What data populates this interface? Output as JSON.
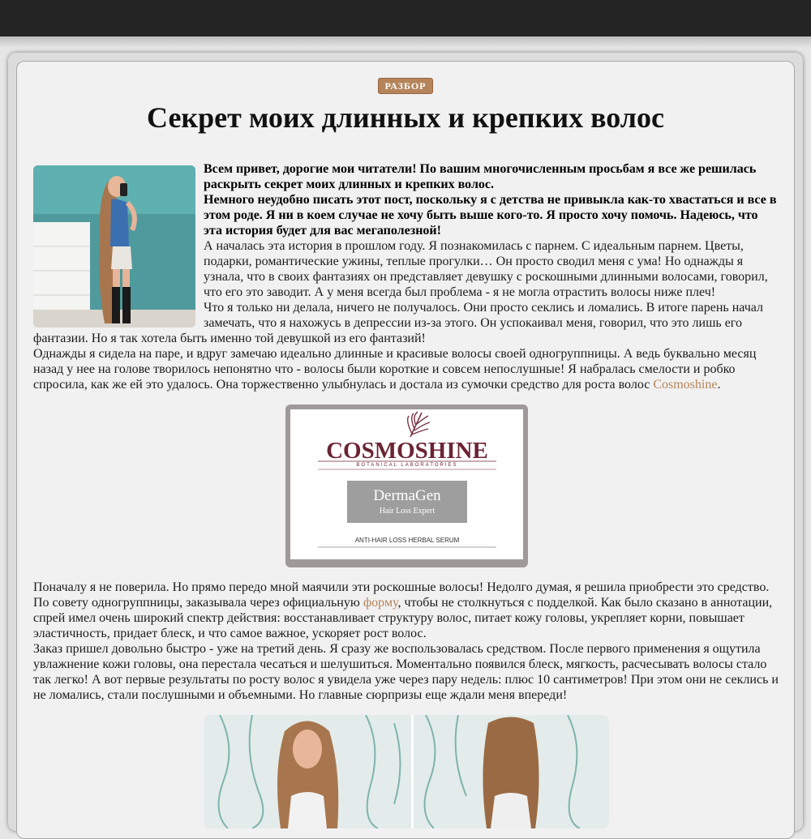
{
  "header": {},
  "article": {
    "badge": "РАЗБОР",
    "title": "Секрет моих длинных и крепких волос",
    "intro_bold_1": "Всем привет, дорогие мои читатели! По вашим многочисленным просьбам я все же решилась раскрыть секрет моих длинных и крепких волос.",
    "intro_bold_2": "Немного неудобно писать этот пост, поскольку я с детства не привыкла как-то хвастаться и все в этом роде. Я ни в коем случае не хочу быть выше кого-то. Я просто хочу помочь. Надеюсь, что эта история будет для вас мегаполезной!",
    "p1": "А началась эта история в прошлом году. Я познакомилась с парнем. С идеальным парнем. Цветы, подарки, романтические ужины, теплые прогулки… Он просто сводил меня с ума! Но однажды я узнала, что в своих фантазиях он представляет девушку с роскошными длинными волосами, говорил, что его это заводит. А у меня всегда был проблема - я не могла отрастить волосы ниже плеч!",
    "p2": "Что я только ни делала, ничего не получалось. Они просто секлись и ломались. В итоге парень начал замечать, что я нахожусь в депрессии из-за этого. Он успокаивал меня, говорил, что это лишь его фантазии. Но я так хотела быть именно той девушкой из его фантазий!",
    "p3_text": "Однажды я сидела на паре, и вдруг замечаю идеально длинные и красивые волосы своей одногруппницы. А ведь буквально месяц назад у нее на голове творилось непонятно что - волосы были короткие и совсем непослушные! Я набралась смелости и робко спросила, как же ей это удалось. Она торжественно улыбнулась и достала из сумочки средство для роста волос ",
    "p3_link": "Cosmoshine",
    "p3_end": ".",
    "p4_text_a": "Поначалу я не поверила. Но прямо передо мной маячили эти роскошные волосы! Недолго думая, я решила приобрести это средство. По совету одногруппницы, заказывала через официальную ",
    "p4_link": "форму",
    "p4_text_b": ", чтобы не столкнуться с подделкой. Как было сказано в аннотации, спрей имел очень широкий спектр действия: восстанавливает структуру волос, питает кожу головы, укрепляет корни, повышает эластичность, придает блеск, и что самое важное, ускоряет рост волос.",
    "p5": "Заказ пришел довольно быстро - уже на третий день. Я сразу же воспользовалась средством. После первого применения я ощутила увлажнение кожи головы, она перестала чесаться и шелушиться. Моментально появился блеск, мягкость, расчесывать волосы стало так легко! А вот первые результаты по росту волос я увидела уже через пару недель: плюс 10 сантиметров! При этом они не секлись и не ломались, стали послушными и объемными. Но главные сюрпризы еще ждали меня впереди!"
  },
  "product": {
    "brand": "COSMOSHINE",
    "brand_sub": "BOTANICAL LABORATORIES",
    "line1": "DermaGen",
    "line2": "Hair Loss Expert",
    "caption": "ANTI-HAIR LOSS HERBAL SERUM"
  },
  "colors": {
    "accent": "#b5845a",
    "topbar": "#242424",
    "article_bg": "#f1f1f1",
    "brand": "#6b2433"
  }
}
